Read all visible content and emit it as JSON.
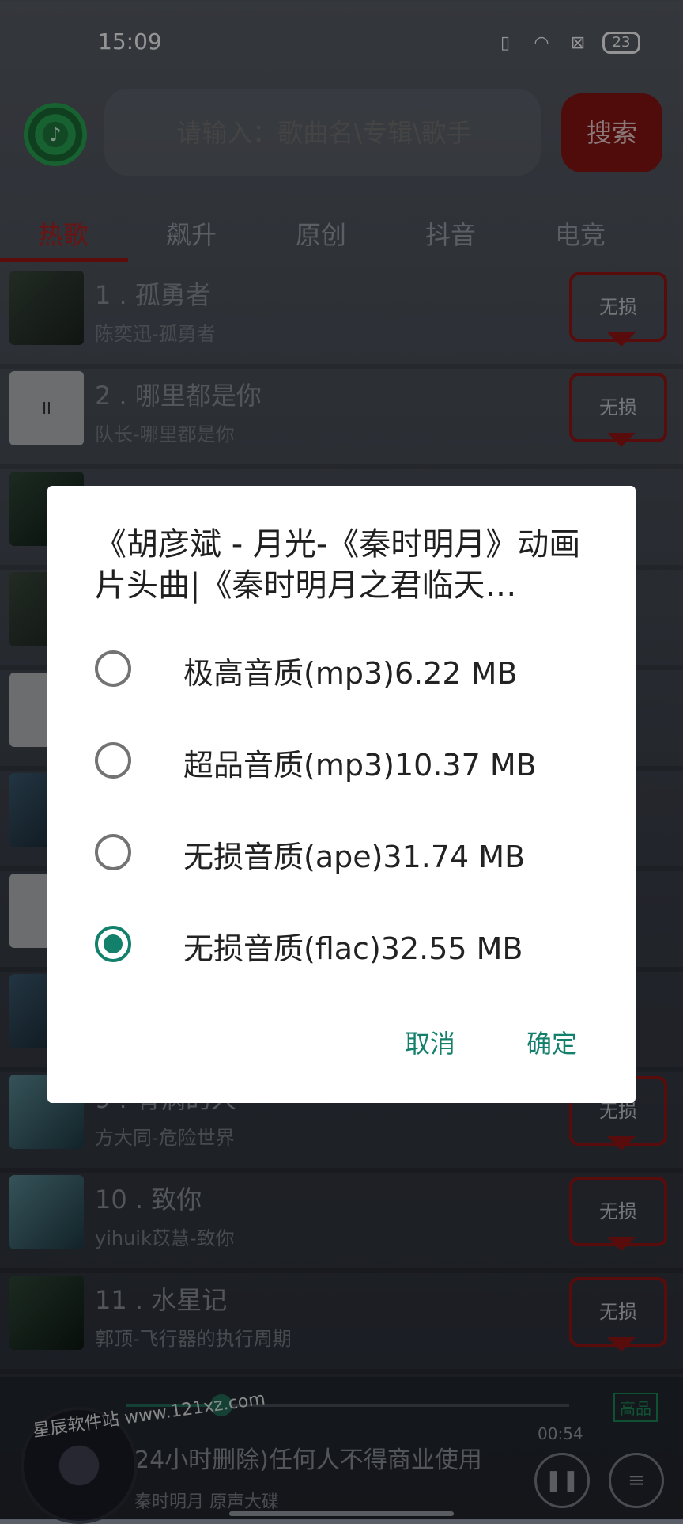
{
  "status_bar": {
    "time": "15:09",
    "battery": "23"
  },
  "search": {
    "placeholder": "请输入：歌曲名\\专辑\\歌手",
    "button_label": "搜索"
  },
  "tabs": [
    {
      "label": "热歌",
      "active": true
    },
    {
      "label": "飙升"
    },
    {
      "label": "原创"
    },
    {
      "label": "抖音"
    },
    {
      "label": "电竞"
    }
  ],
  "songs": [
    {
      "title": "1 . 孤勇者",
      "subtitle": "陈奕迅-孤勇者",
      "quality": "无损"
    },
    {
      "title": "2 . 哪里都是你",
      "subtitle": "队长-哪里都是你",
      "quality": "无损"
    },
    {
      "title": "9 . 有病的人",
      "subtitle": "方大同-危险世界",
      "quality": "无损"
    },
    {
      "title": "10 . 致你",
      "subtitle": "yihuik苡慧-致你",
      "quality": "无损"
    },
    {
      "title": "11 . 水星记",
      "subtitle": "郭顶-飞行器的执行周期",
      "quality": "无损"
    }
  ],
  "player": {
    "quality_badge": "高品",
    "time": "00:54",
    "title": "24小时删除)任何人不得商业使用",
    "artist": "秦时明月 原声大碟",
    "watermark": "星辰软件站 www.121xz.com",
    "pause_icon": "pause-icon",
    "menu_icon": "menu-icon"
  },
  "dialog": {
    "title": "《胡彦斌 - 月光-《秦时明月》动画片头曲|《秦时明月之君临天…",
    "options": [
      {
        "label": "极高音质(mp3)6.22 MB",
        "checked": false
      },
      {
        "label": "超品音质(mp3)10.37 MB",
        "checked": false
      },
      {
        "label": "无损音质(ape)31.74 MB",
        "checked": false
      },
      {
        "label": "无损音质(flac)32.55 MB",
        "checked": true
      }
    ],
    "cancel_label": "取消",
    "ok_label": "确定"
  },
  "colors": {
    "accent": "#13806b",
    "brand_red": "#9a1515"
  }
}
